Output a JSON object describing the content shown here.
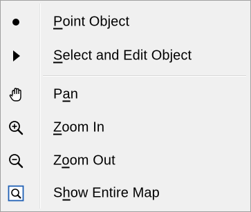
{
  "menu": {
    "items": [
      {
        "icon": "bullet-dot-icon",
        "before": "",
        "accel": "P",
        "after": "oint Object"
      },
      {
        "icon": "arrow-pointer-icon",
        "before": "",
        "accel": "S",
        "after": "elect and Edit Object"
      },
      {
        "icon": "hand-pan-icon",
        "before": "P",
        "accel": "a",
        "after": "n"
      },
      {
        "icon": "zoom-in-icon",
        "before": "",
        "accel": "Z",
        "after": "oom In"
      },
      {
        "icon": "zoom-out-icon",
        "before": "Z",
        "accel": "o",
        "after": "om Out"
      },
      {
        "icon": "show-entire-map-icon",
        "before": "S",
        "accel": "h",
        "after": "ow Entire Map"
      }
    ]
  },
  "colors": {
    "background": "#f0f0f0",
    "border": "#a0a0a0",
    "text": "#000000",
    "map_icon_accent": "#1e5fb4"
  }
}
